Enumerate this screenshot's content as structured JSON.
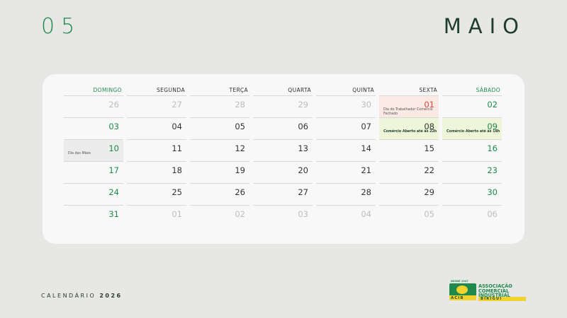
{
  "month": {
    "number": "05",
    "name": "MAIO"
  },
  "weekdays": [
    "DOMINGO",
    "SEGUNDA",
    "TERÇA",
    "QUARTA",
    "QUINTA",
    "SEXTA",
    "SÁBADO"
  ],
  "weeks": [
    [
      {
        "d": "26"
      },
      {
        "d": "27"
      },
      {
        "d": "28"
      },
      {
        "d": "29"
      },
      {
        "d": "30"
      },
      {
        "d": "01",
        "note": "Dia do Trabalhador Comércio Fechado"
      },
      {
        "d": "02"
      }
    ],
    [
      {
        "d": "03"
      },
      {
        "d": "04"
      },
      {
        "d": "05"
      },
      {
        "d": "06"
      },
      {
        "d": "07"
      },
      {
        "d": "08",
        "note": "Comércio Aberto até às 22h"
      },
      {
        "d": "09",
        "note": "Comércio Aberto até às 18h"
      }
    ],
    [
      {
        "d": "10",
        "note": "Dia das Mães"
      },
      {
        "d": "11"
      },
      {
        "d": "12"
      },
      {
        "d": "13"
      },
      {
        "d": "14"
      },
      {
        "d": "15"
      },
      {
        "d": "16"
      }
    ],
    [
      {
        "d": "17"
      },
      {
        "d": "18"
      },
      {
        "d": "19"
      },
      {
        "d": "20"
      },
      {
        "d": "21"
      },
      {
        "d": "22"
      },
      {
        "d": "23"
      }
    ],
    [
      {
        "d": "24"
      },
      {
        "d": "25"
      },
      {
        "d": "26"
      },
      {
        "d": "27"
      },
      {
        "d": "28"
      },
      {
        "d": "29"
      },
      {
        "d": "30"
      }
    ],
    [
      {
        "d": "31"
      },
      {
        "d": "01"
      },
      {
        "d": "02"
      },
      {
        "d": "03"
      },
      {
        "d": "04"
      },
      {
        "d": "05"
      },
      {
        "d": "06"
      }
    ]
  ],
  "footer": {
    "label": "CALENDÁRIO",
    "year": "2026"
  },
  "logo": {
    "since": "DESDE 1947",
    "line1": "ASSOCIAÇÃO",
    "line2": "COMERCIAL",
    "line3": "INDUSTRIAL",
    "acib": "ACIB",
    "city": "BIRIGUI"
  },
  "colors": {
    "green": "#1f8a4c",
    "holiday": "#d94747",
    "open": "#eef5d8",
    "background": "#e7e7e6"
  }
}
